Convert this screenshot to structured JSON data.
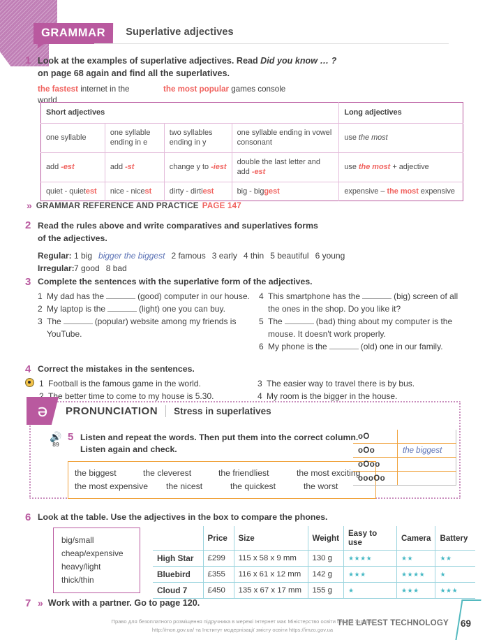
{
  "grammar": {
    "badge": "GRAMMAR",
    "subtitle": "Superlative adjectives",
    "exercise1": {
      "number": "1",
      "line1": "Look at the examples of superlative adjectives. Read ",
      "line1_italic": "Did you know … ?",
      "line2": "on page 68 again and find all the superlatives.",
      "example1_bold": "the fastest",
      "example1_rest": " internet in the world",
      "example2_bold": "the most popular",
      "example2_rest": " games console"
    },
    "table": {
      "header_short": "Short adjectives",
      "header_long": "Long adjectives",
      "row1": {
        "c1": "one syllable",
        "c2": "one syllable ending in e",
        "c3": "two syllables ending in y",
        "c4": "one syllable ending in vowel consonant",
        "c5_plain": "use ",
        "c5_italic": "the most"
      },
      "row2": {
        "c1_plain": "add ",
        "c1_suffix": "-est",
        "c2_plain": "add ",
        "c2_suffix": "-st",
        "c3_plain": "change y to ",
        "c3_suffix": "-iest",
        "c4_plain": "double the last letter and add ",
        "c4_suffix": "-est",
        "c5_plain": "use ",
        "c5_italic": "the most",
        "c5_tail": " + adjective"
      },
      "row3": {
        "c1_plain": "quiet - quiet",
        "c1_suffix": "est",
        "c2_plain": "nice - nice",
        "c2_suffix": "st",
        "c3_plain": "dirty - dirti",
        "c3_suffix": "est",
        "c4_plain": "big - big",
        "c4_suffix": "gest",
        "c5_pre": "expensive – ",
        "c5_red": "the most",
        "c5_post": " expensive"
      }
    },
    "reference": {
      "chevron": "»",
      "label": "GRAMMAR REFERENCE AND PRACTICE",
      "page": "PAGE 147"
    },
    "exercise2": {
      "number": "2",
      "line1": "Read the rules above and write comparatives and superlatives forms",
      "line2": "of the adjectives.",
      "regular_label": "Regular:",
      "regular_items": [
        "1 big",
        "2 famous",
        "3 early",
        "4 thin",
        "5 beautiful",
        "6 young"
      ],
      "regular_answer": "bigger the biggest",
      "irregular_label": "Irregular:",
      "irregular_items": [
        "7 good",
        "8 bad"
      ]
    },
    "exercise3": {
      "number": "3",
      "instruction": "Complete the sentences with the superlative form of the adjectives.",
      "left": [
        {
          "n": "1",
          "pre": "My dad has the",
          "post": "(good) computer in our house."
        },
        {
          "n": "2",
          "pre": "My laptop is the",
          "post": "(light) one you can buy."
        },
        {
          "n": "3",
          "pre": "The",
          "post": "(popular) website among my friends is YouTube."
        }
      ],
      "right": [
        {
          "n": "4",
          "pre": "This smartphone has the",
          "post": "(big) screen of all the ones in the shop. Do you like it?"
        },
        {
          "n": "5",
          "pre": "The",
          "post": "(bad) thing about my computer is the mouse. It doesn't work properly."
        },
        {
          "n": "6",
          "pre": "My phone is the",
          "post": "(old) one in our family."
        }
      ]
    },
    "exercise4": {
      "number": "4",
      "instruction": "Correct the mistakes in the sentences.",
      "left": [
        {
          "n": "1",
          "text": "Football is the famous game in the world."
        },
        {
          "n": "2",
          "text": "The better time to come to my house is 5.30."
        }
      ],
      "right": [
        {
          "n": "3",
          "text": "The easier way to travel there is by bus."
        },
        {
          "n": "4",
          "text": "My room is the bigger in the house."
        }
      ]
    }
  },
  "pronunciation": {
    "badge_symbol": "ə",
    "title": "PRONUNCIATION",
    "subtitle": "Stress in superlatives",
    "exercise5": {
      "number": "5",
      "audio_icon": "speaker-icon",
      "audio_track": "89",
      "line1": "Listen and repeat the words. Then put them into the correct column.",
      "line2": "Listen again and check.",
      "words_row1": [
        "the biggest",
        "the cleverest",
        "the friendliest",
        "the most exciting"
      ],
      "words_row2": [
        "the most expensive",
        "the nicest",
        "the quickest",
        "the worst"
      ]
    },
    "stress_table": [
      {
        "pattern": "oO",
        "example": ""
      },
      {
        "pattern": "oOo",
        "example": "the biggest"
      },
      {
        "pattern": "oOoo",
        "example": ""
      },
      {
        "pattern": "oooOo",
        "example": ""
      }
    ]
  },
  "exercise6": {
    "number": "6",
    "instruction": "Look at the table. Use the adjectives in the box to compare the phones.",
    "adjective_box": [
      "big/small",
      "cheap/expensive",
      "heavy/light",
      "thick/thin"
    ],
    "table": {
      "headers": [
        "",
        "Price",
        "Size",
        "Weight",
        "Easy to use",
        "Camera",
        "Battery"
      ],
      "rows": [
        {
          "name": "High Star",
          "price": "£299",
          "size": "115 x 58 x 9 mm",
          "weight": "130 g",
          "easy_to_use": "★★★★",
          "camera": "★★",
          "battery": "★★"
        },
        {
          "name": "Bluebird",
          "price": "£355",
          "size": "116 x 61 x 12 mm",
          "weight": "142 g",
          "easy_to_use": "★★★",
          "camera": "★★★★",
          "battery": "★"
        },
        {
          "name": "Cloud 7",
          "price": "£450",
          "size": "135 x 67 x 17 mm",
          "weight": "155 g",
          "easy_to_use": "★",
          "camera": "★★★",
          "battery": "★★★"
        }
      ]
    }
  },
  "exercise7": {
    "number": "7",
    "chevron": "»",
    "instruction": "Work with a partner. Go to page 120."
  },
  "footer": {
    "unit_title": "THE LATEST TECHNOLOGY",
    "page_number": "69",
    "watermark_line1": "Право для безоплатного розміщення підручника в мережі Інтернет має Міністерство освіти і науки України",
    "watermark_line2": "http://mon.gov.ua/ та Інститут модернізації змісту освіти https://imzo.gov.ua"
  },
  "colors": {
    "magenta": "#b9599f",
    "red": "#f0625e",
    "teal": "#45b8c4",
    "orange": "#f0a23c",
    "blue_answer": "#5b72b5"
  }
}
